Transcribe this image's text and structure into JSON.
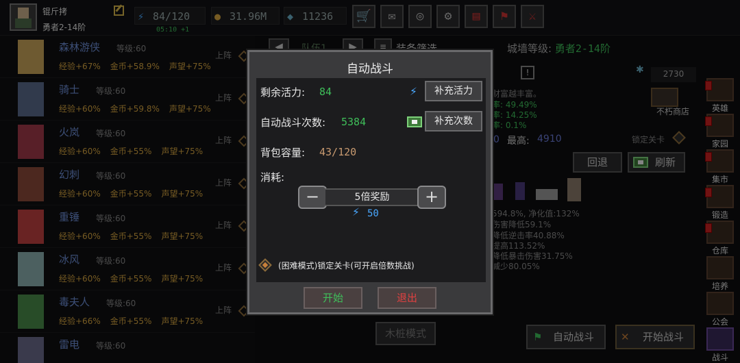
{
  "player": {
    "name": "锟斤拷",
    "rank": "勇者2-14阶"
  },
  "resources": {
    "energy": "84/120",
    "energy_timer": "05:10 +1",
    "gold": "31.96M",
    "gems": "11236"
  },
  "toolbar_icons": [
    "cart-icon",
    "mail-icon",
    "gamepad-icon",
    "gear-icon",
    "scroll-icon",
    "flag-icon",
    "swords-icon"
  ],
  "heroes": [
    {
      "name": "森林游侠",
      "level": "等级:60",
      "exp": "经验+67%",
      "gold": "金币+58.9%",
      "fame": "声望+75%",
      "deploy": "上阵",
      "color": "#c9a45a"
    },
    {
      "name": "骑士",
      "level": "等级:60",
      "exp": "经验+60%",
      "gold": "金币+59.8%",
      "fame": "声望+75%",
      "deploy": "上阵",
      "color": "#5a6a8a"
    },
    {
      "name": "火岚",
      "level": "等级:60",
      "exp": "经验+60%",
      "gold": "金币+55%",
      "fame": "声望+75%",
      "deploy": "上阵",
      "color": "#a03a4a"
    },
    {
      "name": "幻刺",
      "level": "等级:60",
      "exp": "经验+60%",
      "gold": "金币+55%",
      "fame": "声望+75%",
      "deploy": "上阵",
      "color": "#8a4a3a"
    },
    {
      "name": "重锤",
      "level": "等级:60",
      "exp": "经验+60%",
      "gold": "金币+55%",
      "fame": "声望+75%",
      "deploy": "上阵",
      "color": "#c04040"
    },
    {
      "name": "冰风",
      "level": "等级:60",
      "exp": "经验+60%",
      "gold": "金币+55%",
      "fame": "声望+75%",
      "deploy": "上阵",
      "color": "#8ab0b0"
    },
    {
      "name": "毒夫人",
      "level": "等级:60",
      "exp": "经验+66%",
      "gold": "金币+55%",
      "fame": "声望+75%",
      "deploy": "上阵",
      "color": "#4a8a4a"
    },
    {
      "name": "雷电",
      "level": "等级:60",
      "exp": "",
      "gold": "",
      "fame": "",
      "deploy": "",
      "color": "#6a6a8a"
    }
  ],
  "middle": {
    "team_tab": "队伍1",
    "equip_filter": "装备筛选",
    "wall_label": "城墙等级:",
    "wall_value": "勇者2-14阶",
    "wealth_text": "财富越丰富。",
    "rate1": "率: 49.49%",
    "rate2": "率: 14.25%",
    "rate3": "率: 0.1%",
    "best_label": "最高:",
    "best_value": "4910",
    "score": "2730",
    "shop": "不朽商店",
    "lock_stage": "锁定关卡",
    "back": "回退",
    "refresh": "刷新",
    "stat1": "594.8%, 净化值:132%",
    "stat2": "伤害降低59.1%",
    "stat3": "降低逆击率40.88%",
    "stat4": "提高113.52%",
    "stat5": "降低暴击伤害31.75%",
    "stat6": "减少80.05%",
    "stake_mode": "木桩模式",
    "auto_battle_btn": "自动战斗",
    "start_battle_btn": "开始战斗"
  },
  "sidebar": [
    "英雄",
    "家园",
    "集市",
    "锻造",
    "仓库",
    "培养",
    "公会",
    "战斗"
  ],
  "modal": {
    "title": "自动战斗",
    "energy_label": "剩余活力:",
    "energy_value": "84",
    "refill_energy": "补充活力",
    "count_label": "自动战斗次数:",
    "count_value": "5384",
    "refill_count": "补充次数",
    "bag_label": "背包容量:",
    "bag_value": "43/120",
    "cost_label": "消耗:",
    "multiplier": "5倍奖励",
    "cost_value": "50",
    "hard_mode": "(困难模式)锁定关卡(可开启倍数挑战)",
    "start": "开始",
    "exit": "退出"
  }
}
